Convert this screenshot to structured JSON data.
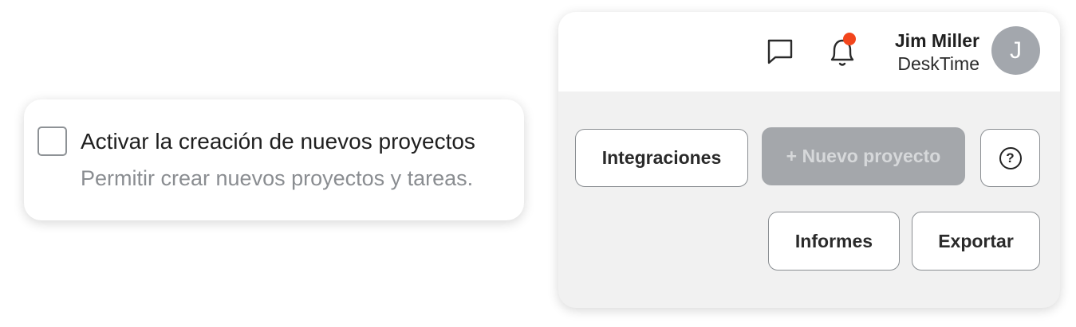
{
  "setting": {
    "checkbox_checked": false,
    "title": "Activar la creación de nuevos proyectos",
    "description": "Permitir crear nuevos proyectos y tareas."
  },
  "header": {
    "chat_icon": "chat-bubble-icon",
    "notification_icon": "bell-icon",
    "has_notification": true,
    "notification_color": "#f2451c",
    "user_name": "Jim Miller",
    "user_company": "DeskTime",
    "avatar_initial": "J"
  },
  "actions": {
    "integrations_label": "Integraciones",
    "new_project_label": "+ Nuevo proyecto",
    "new_project_disabled": true,
    "help_icon": "question-circle-icon",
    "help_glyph": "?",
    "reports_label": "Informes",
    "export_label": "Exportar"
  }
}
